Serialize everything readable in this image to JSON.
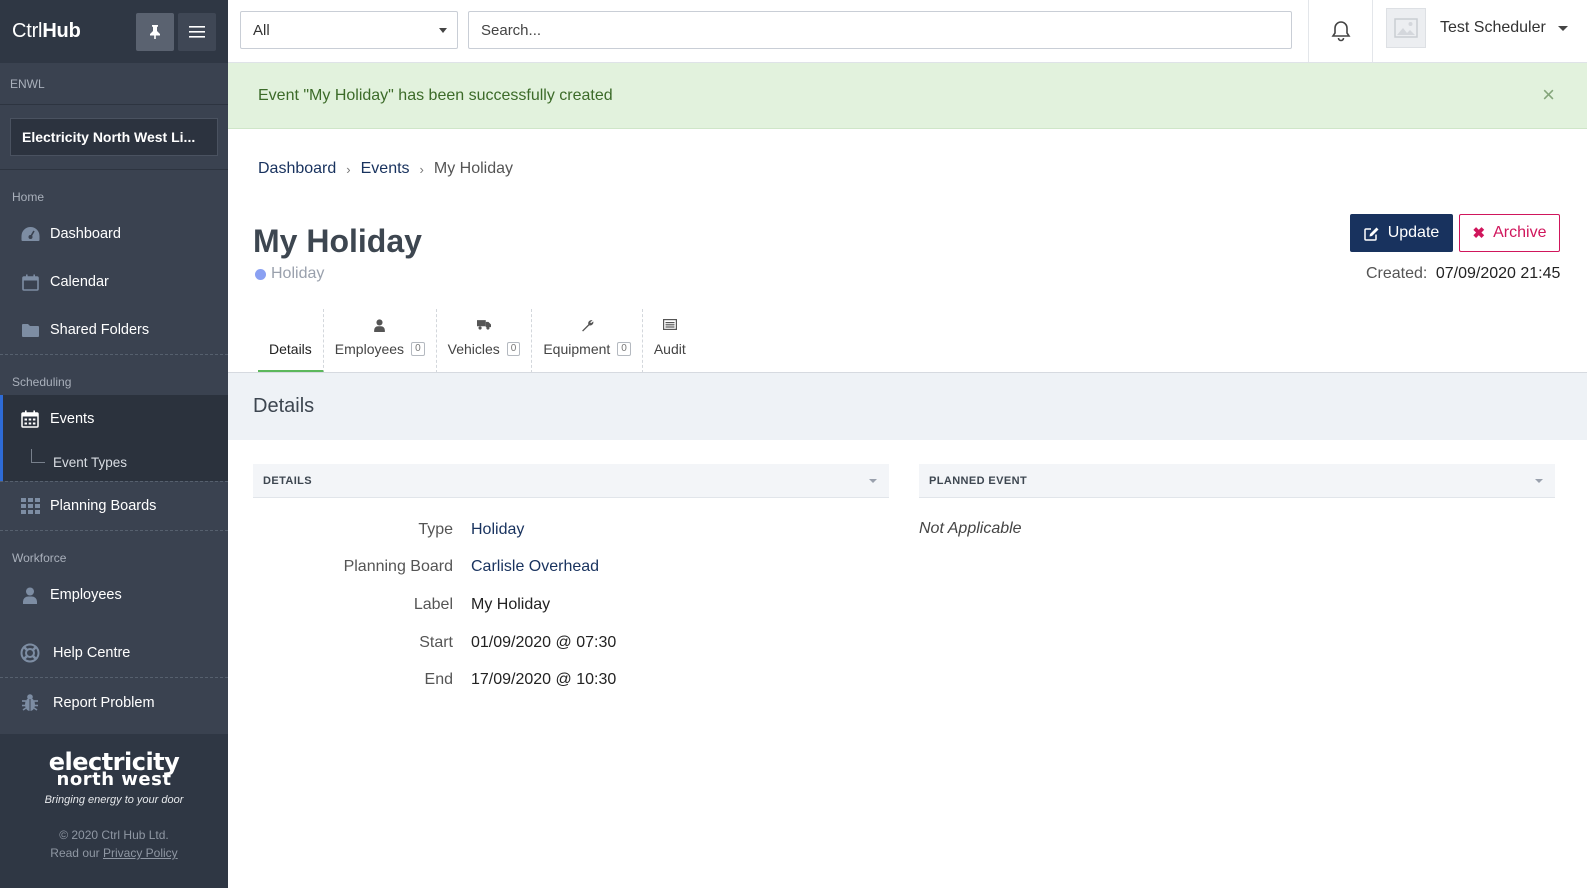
{
  "sidebar": {
    "brand_light": "Ctrl",
    "brand_bold": "Hub",
    "org_label": "ENWL",
    "org_selected": "Electricity North West Li...",
    "sections": {
      "home": "Home",
      "scheduling": "Scheduling",
      "workforce": "Workforce"
    },
    "items": {
      "dashboard": "Dashboard",
      "calendar": "Calendar",
      "shared_folders": "Shared Folders",
      "events": "Events",
      "event_types": "Event Types",
      "planning_boards": "Planning Boards",
      "employees": "Employees",
      "help_centre": "Help Centre",
      "report_problem": "Report Problem"
    },
    "footer": {
      "logo_line1": "electricity",
      "logo_line2": "north west",
      "tagline": "Bringing energy to your door",
      "copyright": "© 2020 Ctrl Hub Ltd.",
      "read_our": "Read our ",
      "privacy": "Privacy Policy"
    }
  },
  "topbar": {
    "filter_value": "All",
    "search_placeholder": "Search...",
    "user_name": "Test Scheduler"
  },
  "alert": {
    "message": "Event \"My Holiday\" has been successfully created",
    "close": "×"
  },
  "breadcrumb": {
    "dashboard": "Dashboard",
    "events": "Events",
    "current": "My Holiday"
  },
  "event": {
    "title": "My Holiday",
    "type": "Holiday",
    "type_color": "#8aa0f2",
    "created_label": "Created:",
    "created_value": "07/09/2020 21:45"
  },
  "actions": {
    "update": "Update",
    "archive": "Archive"
  },
  "tabs": {
    "details": "Details",
    "employees": "Employees",
    "employees_count": "0",
    "vehicles": "Vehicles",
    "vehicles_count": "0",
    "equipment": "Equipment",
    "equipment_count": "0",
    "audit": "Audit"
  },
  "section_title": "Details",
  "panels": {
    "details_header": "DETAILS",
    "planned_header": "PLANNED EVENT",
    "planned_value": "Not Applicable"
  },
  "details": {
    "type_label": "Type",
    "type_value": "Holiday",
    "board_label": "Planning Board",
    "board_value": "Carlisle Overhead",
    "label_label": "Label",
    "label_value": "My Holiday",
    "start_label": "Start",
    "start_value": "01/09/2020 @ 07:30",
    "end_label": "End",
    "end_value": "17/09/2020 @ 10:30"
  }
}
